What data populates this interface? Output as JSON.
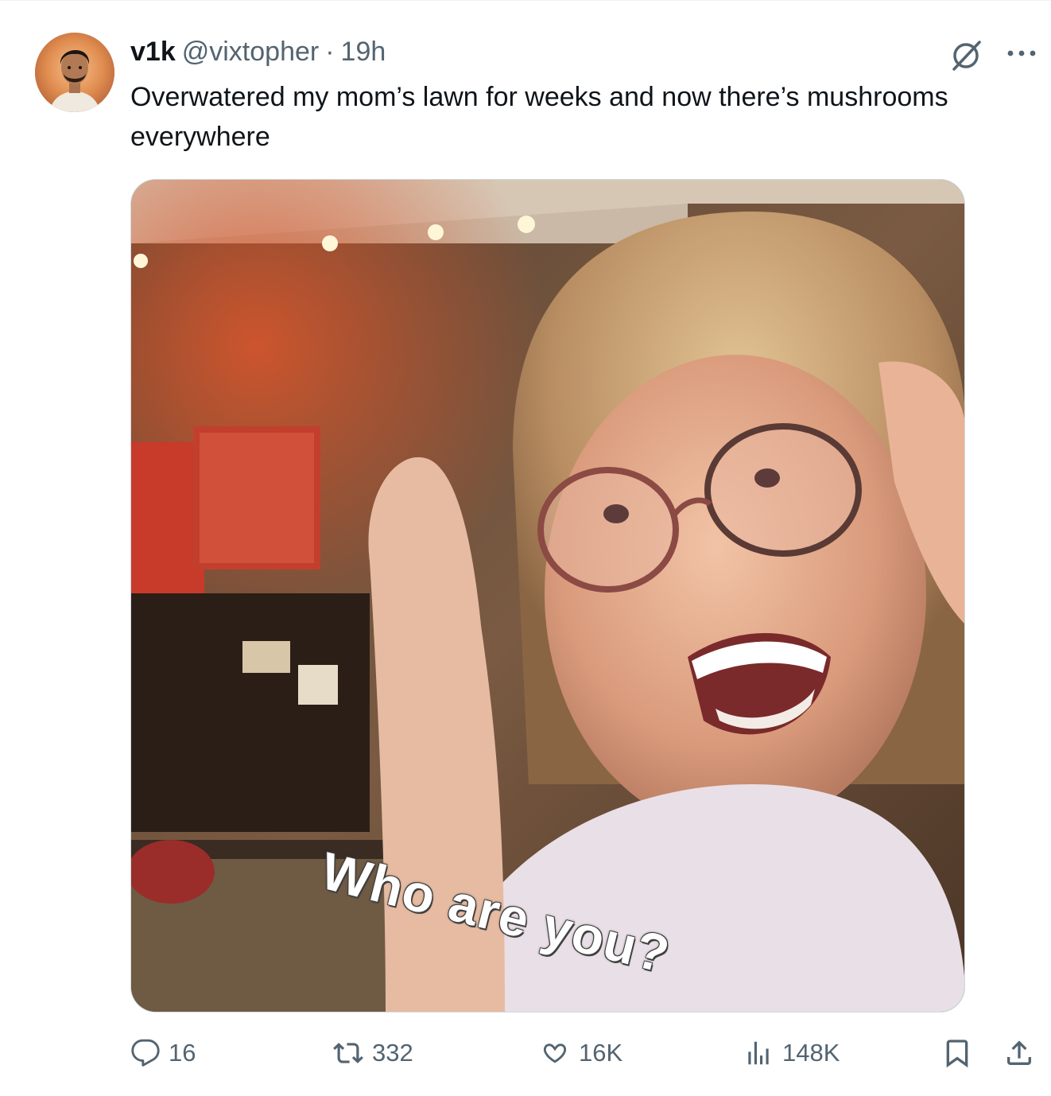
{
  "tweet": {
    "display_name": "v1k",
    "handle": "@vixtopher",
    "separator": "·",
    "time": "19h",
    "text": "Overwatered my mom’s lawn for weeks and now there’s mushrooms everywhere"
  },
  "media": {
    "caption": "Who are you?"
  },
  "actions": {
    "replies": "16",
    "reposts": "332",
    "likes": "16K",
    "views": "148K"
  },
  "icons": {
    "avatar": "avatar",
    "grok": "grok-icon",
    "more": "more-icon",
    "reply": "reply-icon",
    "repost": "repost-icon",
    "like": "heart-icon",
    "views": "views-icon",
    "bookmark": "bookmark-icon",
    "share": "share-icon"
  },
  "colors": {
    "text": "#0f1419",
    "secondary": "#536471",
    "border": "#cfd9de"
  }
}
